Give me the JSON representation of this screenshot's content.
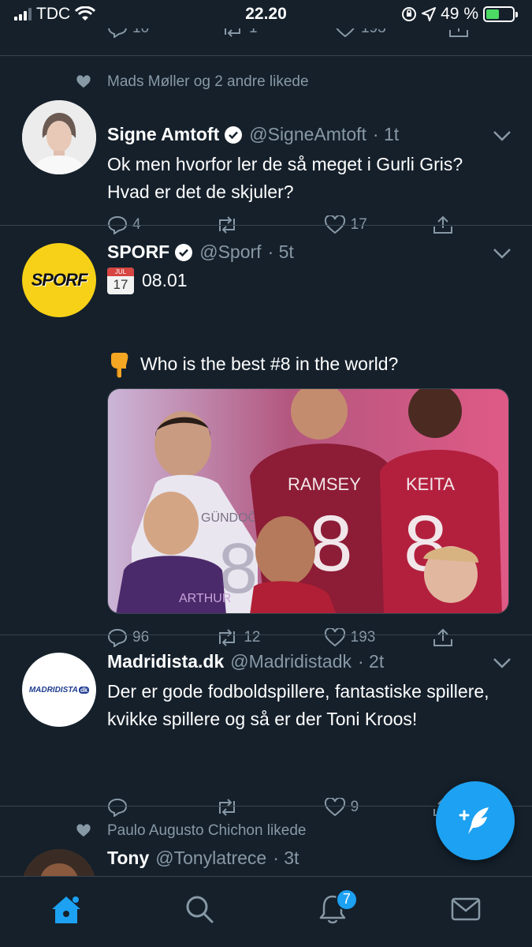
{
  "status_bar": {
    "carrier": "TDC",
    "time": "22.20",
    "battery": "49 %",
    "battery_level": 0.49
  },
  "previous_tweet": {
    "replies": "10",
    "retweets": "1",
    "likes": "193"
  },
  "tweets": [
    {
      "social_context": "Mads Møller og 2 andre likede",
      "name": "Signe Amtoft",
      "handle": "@SigneAmtoft",
      "time": "· 1t",
      "text": "Ok men hvorfor ler de så meget i Gurli Gris? Hvad er det de skjuler?",
      "replies": "4",
      "retweets": "",
      "likes": "17"
    },
    {
      "name": "SPORF",
      "handle": "@Sporf",
      "time": "· 5t",
      "calendar_month": "JUL",
      "calendar_day": "17",
      "date_text": "08.01",
      "text": "Who is the best #8 in the world?",
      "avatar_text": "SPORF",
      "media_labels": {
        "player1": "GÜNDOĞAN",
        "player2": "RAMSEY",
        "player3": "KEITA",
        "player4": "ARTHUR",
        "number": "8"
      },
      "replies": "96",
      "retweets": "12",
      "likes": "193"
    },
    {
      "name": "Madridista.dk",
      "handle": "@Madridistadk",
      "time": "· 2t",
      "text": "Der er gode fodboldspillere, fantastiske spillere, kvikke spillere og så er der Toni Kroos!",
      "avatar_text": "MADRIDISTA",
      "avatar_suffix": "dk",
      "replies": "",
      "retweets": "",
      "likes": "9"
    },
    {
      "social_context": "Paulo Augusto Chichon likede",
      "name": "Tony",
      "handle": "@Tonylatrece",
      "time": "· 3t"
    }
  ],
  "tabbar": {
    "notifications_badge": "7"
  },
  "colors": {
    "background": "#15202b",
    "accent": "#1da1f2",
    "muted": "#8899a6",
    "divider": "#38444d"
  }
}
